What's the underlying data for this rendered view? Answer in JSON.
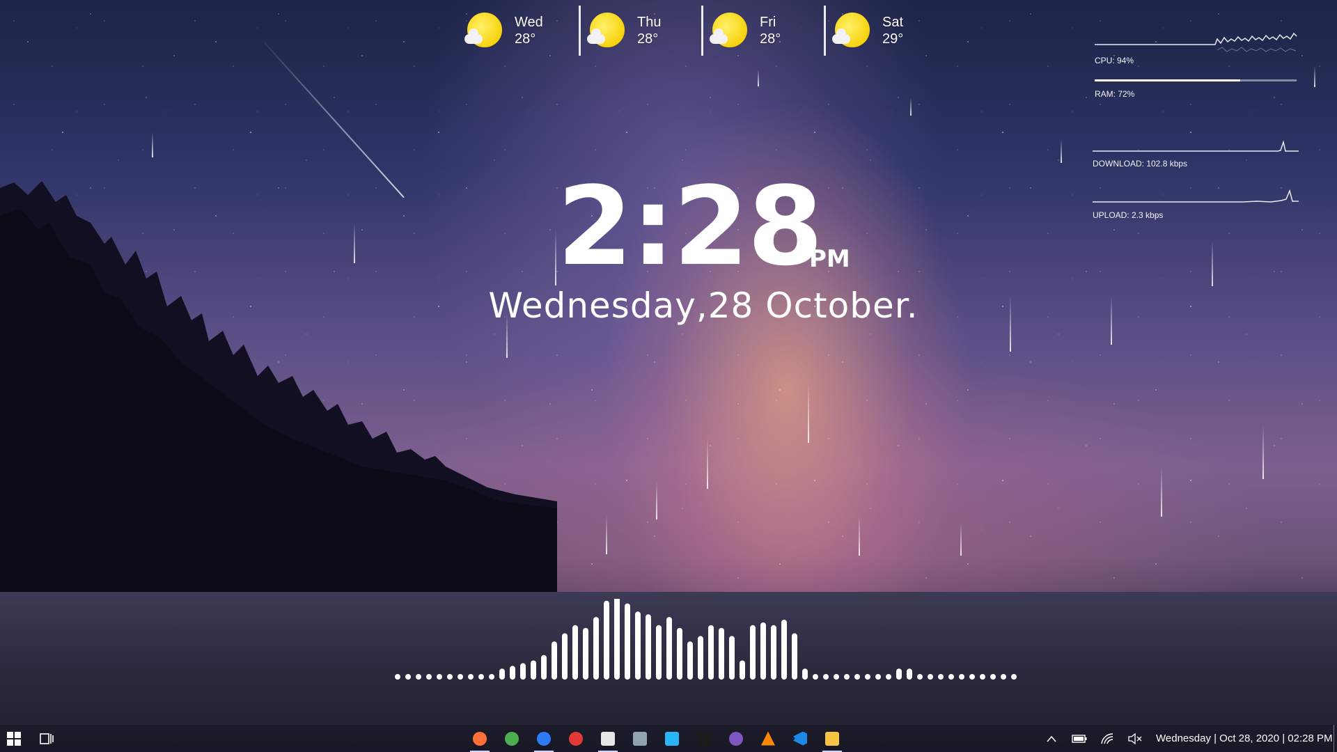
{
  "weather": {
    "days": [
      {
        "day": "Wed",
        "temp": "28°",
        "icon": "sun-cloud-icon"
      },
      {
        "day": "Thu",
        "temp": "28°",
        "icon": "sun-cloud-icon"
      },
      {
        "day": "Fri",
        "temp": "28°",
        "icon": "sun-cloud-icon"
      },
      {
        "day": "Sat",
        "temp": "29°",
        "icon": "sun-cloud-icon"
      }
    ]
  },
  "clock": {
    "time": "2:28",
    "ampm": "PM",
    "date": "Wednesday,28 October."
  },
  "system": {
    "cpu_label": "CPU: 94%",
    "cpu_percent": 94,
    "ram_label": "RAM: 72%",
    "ram_percent": 72,
    "download_label": "DOWNLOAD: 102.8 kbps",
    "upload_label": "UPLOAD: 2.3 kbps"
  },
  "visualizer": {
    "levels": [
      0,
      0,
      0,
      0,
      0,
      0,
      0,
      0,
      0,
      0,
      4,
      6,
      8,
      10,
      14,
      24,
      30,
      36,
      34,
      42,
      54,
      60,
      52,
      46,
      44,
      36,
      42,
      34,
      24,
      28,
      36,
      34,
      28,
      10,
      36,
      38,
      36,
      40,
      30,
      4,
      0,
      0,
      0,
      0,
      0,
      0,
      0,
      0,
      4,
      4,
      0,
      0,
      0,
      0,
      0,
      0,
      0,
      0,
      0,
      0
    ]
  },
  "taskbar": {
    "start_icon": "windows-logo-icon",
    "task_view_icon": "task-view-icon",
    "apps": [
      {
        "name": "firefox",
        "icon": "firefox-icon",
        "color": "#ff7139",
        "active": true
      },
      {
        "name": "chrome",
        "icon": "chrome-icon",
        "color": "#4caf50",
        "active": false
      },
      {
        "name": "firefox-nightly",
        "icon": "firefox-nightly-icon",
        "color": "#2f7bf5",
        "active": true
      },
      {
        "name": "settings-gear",
        "icon": "bug-gear-icon",
        "color": "#e53935",
        "active": false
      },
      {
        "name": "notepad",
        "icon": "notepad-icon",
        "color": "#e6e6e6",
        "active": true
      },
      {
        "name": "calculator",
        "icon": "calculator-icon",
        "color": "#90a4ae",
        "active": false
      },
      {
        "name": "system-info",
        "icon": "system-info-icon",
        "color": "#29b6f6",
        "active": false
      },
      {
        "name": "terminal",
        "icon": "terminal-icon",
        "color": "#1b1b1b",
        "active": false
      },
      {
        "name": "tor",
        "icon": "tor-icon",
        "color": "#7e57c2",
        "active": false
      },
      {
        "name": "vlc",
        "icon": "vlc-icon",
        "color": "#ff8800",
        "active": false
      },
      {
        "name": "vscode",
        "icon": "vscode-icon",
        "color": "#1e88e5",
        "active": false
      },
      {
        "name": "file-explorer",
        "icon": "folder-icon",
        "color": "#f6c343",
        "active": true
      }
    ],
    "tray": {
      "chevron": "^",
      "clock": "Wednesday | Oct 28, 2020 | 02:28 PM"
    }
  }
}
